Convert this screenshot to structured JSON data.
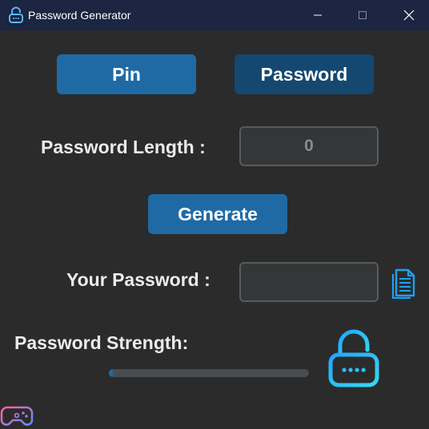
{
  "window": {
    "title": "Password Generator",
    "icons": {
      "app": "lock-icon",
      "minimize": "minimize-icon",
      "maximize": "maximize-icon",
      "close": "close-icon"
    }
  },
  "mode_buttons": {
    "pin_label": "Pin",
    "password_label": "Password"
  },
  "length": {
    "label": "Password Length :",
    "value": "0"
  },
  "generate": {
    "label": "Generate"
  },
  "output": {
    "label": "Your Password :",
    "value": "",
    "copy_icon": "document-copy-icon"
  },
  "strength": {
    "label": "Password Strength:",
    "progress": 0.02,
    "lock_icon": "lock-icon"
  },
  "footer": {
    "icon": "gamepad-icon"
  },
  "colors": {
    "background": "#2b2b2b",
    "titlebar": "#1c2541",
    "button_primary": "#1f6aa5",
    "button_selected": "#144870",
    "entry_bg": "#343638",
    "entry_border": "#565b5e",
    "text": "#ebebeb",
    "progress_track": "#4a4d50",
    "progress_fill": "#1f6aa5",
    "icon_gradient_start": "#1ea7ff",
    "icon_gradient_end": "#37d7f0"
  }
}
